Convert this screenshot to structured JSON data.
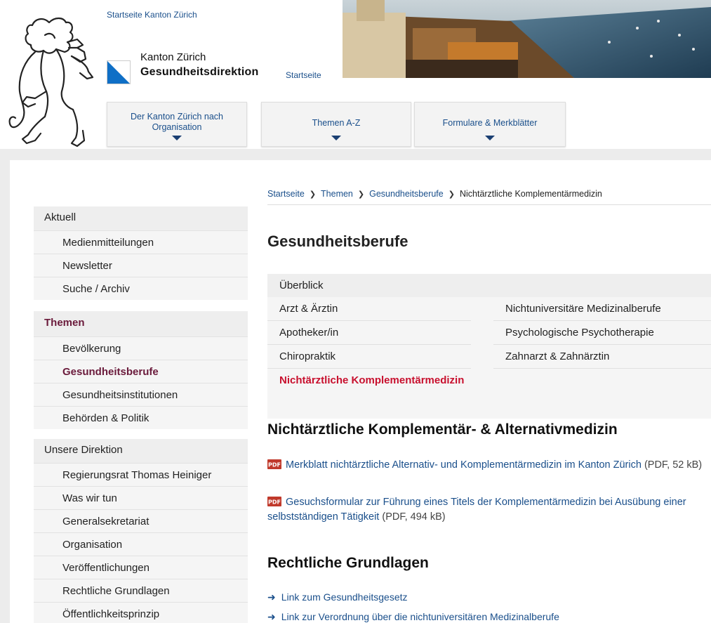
{
  "header": {
    "home_link": "Startseite Kanton Zürich",
    "canton": "Kanton Zürich",
    "directorate": "Gesundheitsdirektion",
    "directorate_home": "Startseite",
    "nav": [
      {
        "label": "Der Kanton Zürich nach Organisation"
      },
      {
        "label": "Themen A-Z"
      },
      {
        "label": "Formulare & Merkblätter"
      }
    ]
  },
  "breadcrumb": [
    "Startseite",
    "Themen",
    "Gesundheitsberufe",
    "Nichtärztliche Komplementärmedizin"
  ],
  "sidebar": {
    "groups": [
      {
        "head": "Aktuell",
        "items": [
          "Medienmitteilungen",
          "Newsletter",
          "Suche / Archiv"
        ]
      },
      {
        "head": "Themen",
        "items": [
          "Bevölkerung",
          "Gesundheitsberufe",
          "Gesundheitsinstitutionen",
          "Behörden & Politik"
        ]
      },
      {
        "head": "Unsere Direktion",
        "items": [
          "Regierungsrat Thomas Heiniger",
          "Was wir tun",
          "Generalsekretariat",
          "Organisation",
          "Veröffentlichungen",
          "Rechtliche Grundlagen",
          "Öffentlichkeitsprinzip"
        ]
      }
    ]
  },
  "main": {
    "title": "Gesundheitsberufe",
    "subnav": {
      "head": "Überblick",
      "col1": [
        "Arzt & Ärztin",
        "Apotheker/in",
        "Chiropraktik",
        "Nichtärztliche Komplementärmedizin"
      ],
      "col2": [
        "Nichtuniversitäre Medizinalberufe",
        "Psychologische Psychotherapie",
        "Zahnarzt & Zahnärztin"
      ]
    },
    "section1": {
      "title": "Nichtärztliche Komplementär- & Alternativmedizin",
      "docs": [
        {
          "text": "Merkblatt nichtärztliche Alternativ- und Komplementärmedizin im Kanton Zürich",
          "meta": "(PDF, 52 kB)"
        },
        {
          "text": "Gesuchsformular zur Führung eines Titels der Komplementärmedizin bei Ausübung einer selbstständigen Tätigkeit",
          "meta": "(PDF, 494 kB)"
        }
      ]
    },
    "section2": {
      "title": "Rechtliche Grundlagen",
      "links": [
        "Link zum Gesundheitsgesetz",
        "Link zur Verordnung über die nichtuniversitären Medizinalberufe"
      ]
    }
  },
  "colors": {
    "link": "#1a4f8b",
    "active_red": "#c8102e",
    "active_purple": "#6a1a3b"
  }
}
